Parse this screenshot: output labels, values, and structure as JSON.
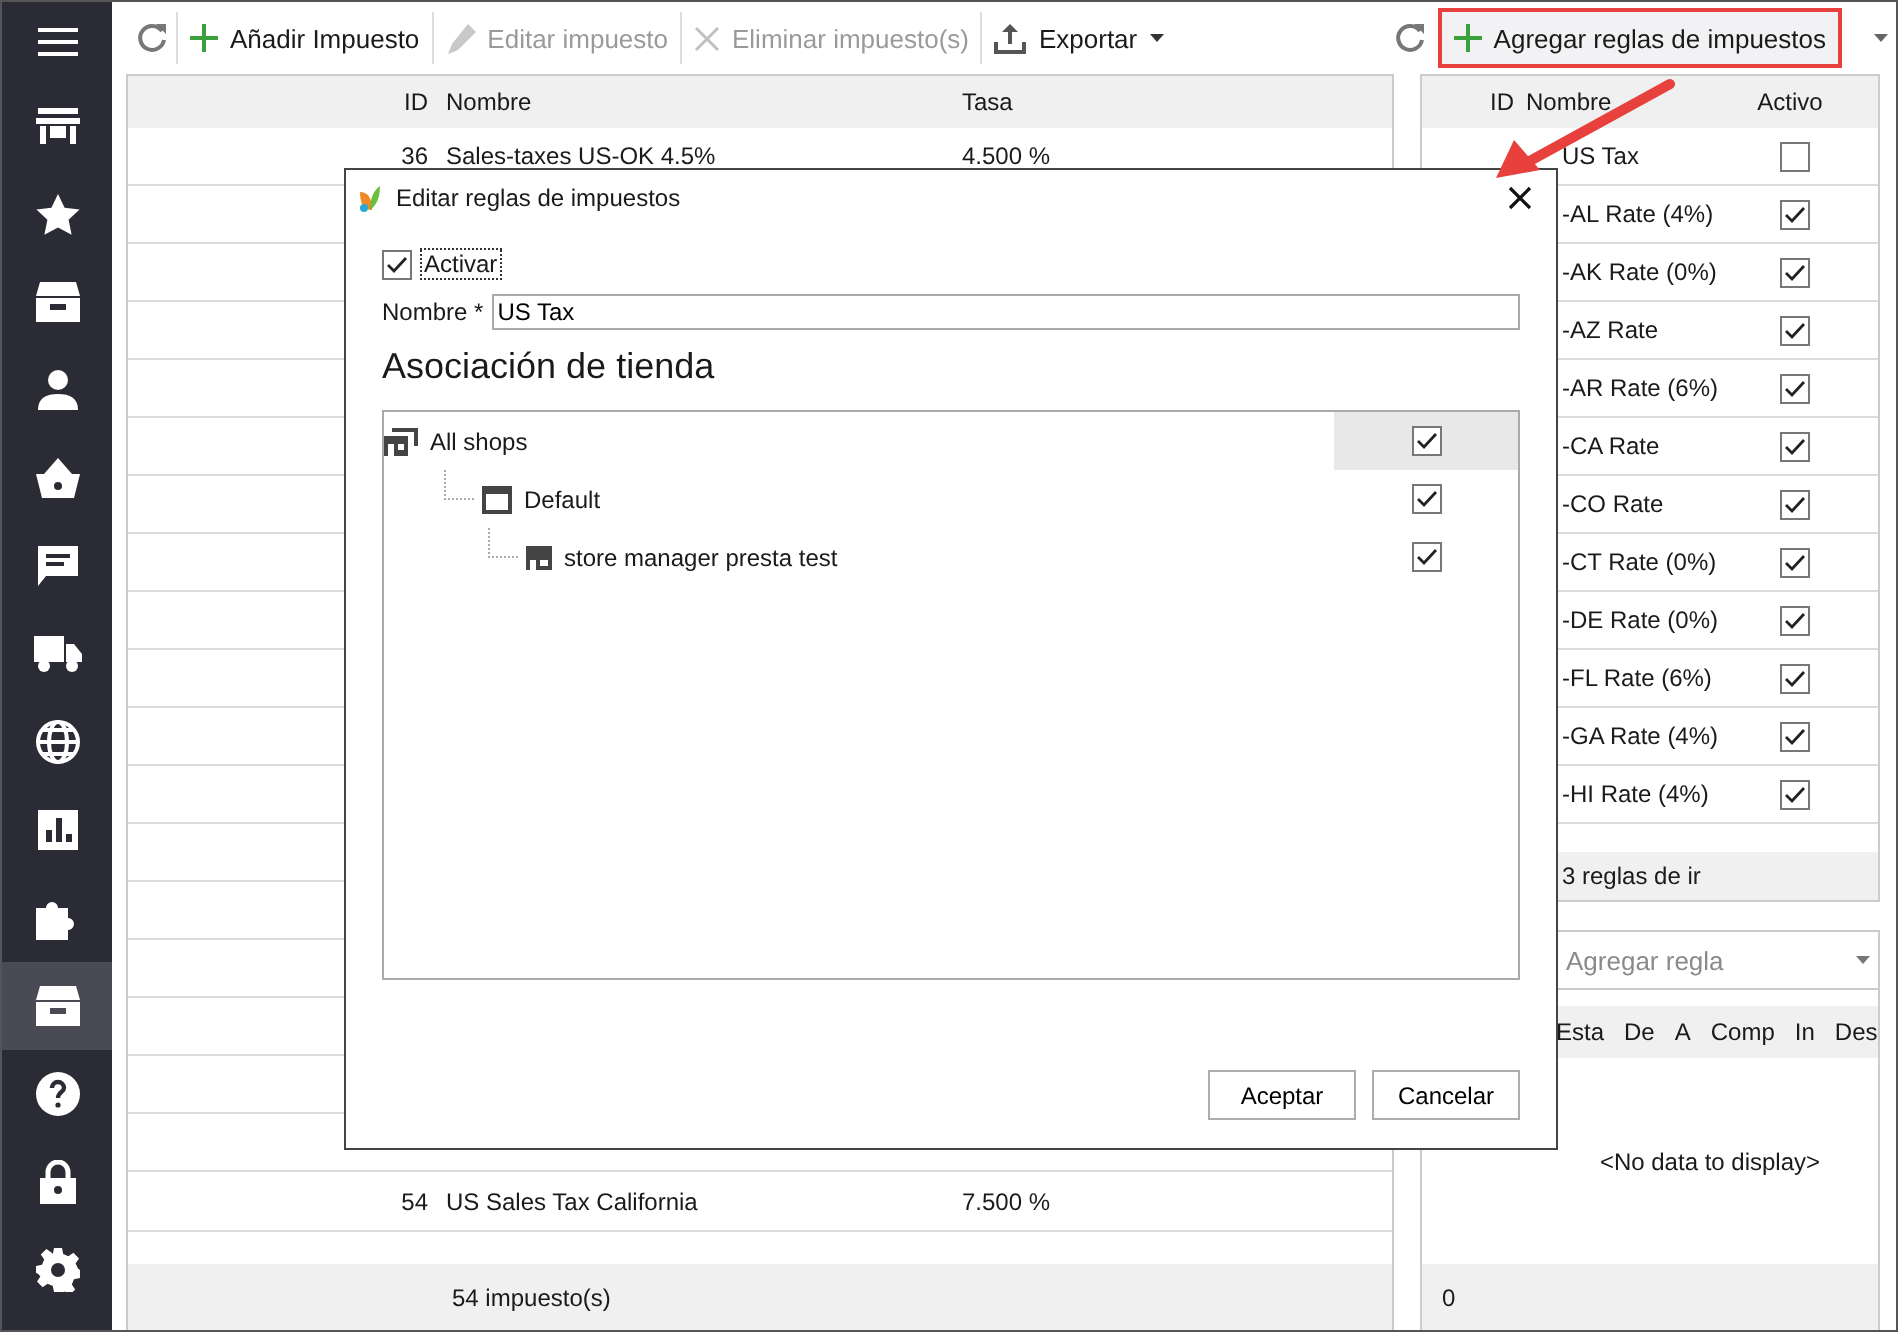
{
  "sidebar": {
    "items": [
      {
        "selected": false
      },
      {
        "selected": false
      },
      {
        "selected": false
      },
      {
        "selected": false
      },
      {
        "selected": false
      },
      {
        "selected": false
      },
      {
        "selected": false
      },
      {
        "selected": false
      },
      {
        "selected": false
      },
      {
        "selected": false
      },
      {
        "selected": false
      },
      {
        "selected": true
      },
      {
        "selected": false
      },
      {
        "selected": false
      },
      {
        "selected": false
      }
    ]
  },
  "toolbar": {
    "buttons": [
      {
        "kind": "refresh"
      },
      {
        "kind": "add",
        "label": "Añadir Impuesto",
        "disabled": false
      },
      {
        "kind": "edit",
        "label": "Editar impuesto",
        "disabled": true
      },
      {
        "kind": "delete",
        "label": "Eliminar impuesto(s)",
        "disabled": true
      },
      {
        "kind": "export",
        "label": "Exportar",
        "disabled": false
      }
    ]
  },
  "right_toolbar": {
    "buttons": [
      {
        "kind": "refresh"
      },
      {
        "kind": "add",
        "label": "Agregar reglas de impuestos",
        "disabled": false,
        "highlighted": true
      }
    ]
  },
  "taxes_table": {
    "columns": [
      "ID",
      "Nombre",
      "Tasa"
    ],
    "rows": [
      [
        "36",
        "Sales-taxes US-OK 4.5%",
        "4.500 %"
      ],
      [
        "54",
        "US Sales Tax California",
        "7.500 %"
      ]
    ],
    "footer": "54 impuesto(s)"
  },
  "rules_table": {
    "columns": [
      "ID",
      "Nombre",
      "Activo"
    ],
    "rows": [
      {
        "name": "US Tax",
        "active": false
      },
      {
        "name": "-AL Rate (4%)",
        "active": true
      },
      {
        "name": "-AK Rate (0%)",
        "active": true
      },
      {
        "name": "-AZ Rate",
        "active": true
      },
      {
        "name": "-AR Rate (6%)",
        "active": true
      },
      {
        "name": "-CA Rate",
        "active": true
      },
      {
        "name": "-CO Rate",
        "active": true
      },
      {
        "name": "-CT Rate (0%)",
        "active": true
      },
      {
        "name": "-DE Rate (0%)",
        "active": true
      },
      {
        "name": "-FL Rate (6%)",
        "active": true
      },
      {
        "name": "-GA Rate (4%)",
        "active": true
      },
      {
        "name": "-HI Rate (4%)",
        "active": true
      }
    ],
    "footer": "3 reglas de ir"
  },
  "rule_panel": {
    "dropdown": {
      "placeholder": "Agregar regla",
      "disabled": true
    },
    "columns": [
      "Esta",
      "De",
      "A",
      "Comp",
      "In",
      "Des"
    ],
    "empty": "<No data to display>",
    "footer": "0"
  },
  "dialog": {
    "title": "Editar reglas de impuestos",
    "activate": {
      "label": "Activar",
      "checked": true
    },
    "name_field": {
      "label": "Nombre *",
      "value": "US Tax"
    },
    "section": "Asociación de tienda",
    "tree": [
      {
        "label": "All shops",
        "checked": true,
        "selected": true,
        "children": [
          {
            "label": "Default",
            "checked": true,
            "selected": false,
            "children": [
              {
                "label": "store manager presta test",
                "checked": true,
                "selected": false
              }
            ]
          }
        ]
      }
    ],
    "buttons": [
      "Aceptar",
      "Cancelar"
    ]
  }
}
